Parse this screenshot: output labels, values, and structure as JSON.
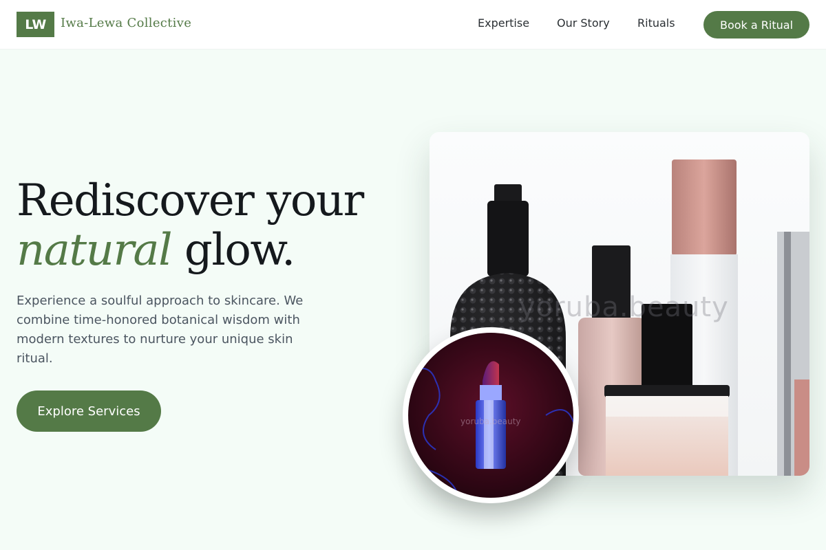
{
  "header": {
    "logo_text": "LW",
    "brand_name": "Iwa-Lewa Collective",
    "nav": [
      {
        "label": "Expertise"
      },
      {
        "label": "Our Story"
      },
      {
        "label": "Rituals"
      }
    ],
    "cta_label": "Book a Ritual"
  },
  "hero": {
    "title_line1": "Rediscover your",
    "title_accent": "natural",
    "title_rest": " glow.",
    "description": "Experience a soulful approach to skincare. We combine time-honored botanical wisdom with modern textures to nurture your unique skin ritual.",
    "button_label": "Explore Services"
  },
  "images": {
    "main_watermark": "yoruba.beauty",
    "circle_watermark": "yoruba.beauty"
  },
  "colors": {
    "brand_green": "#547a47",
    "page_background": "#f4fcf7",
    "heading": "#15191d",
    "body_text": "#4b5560"
  }
}
